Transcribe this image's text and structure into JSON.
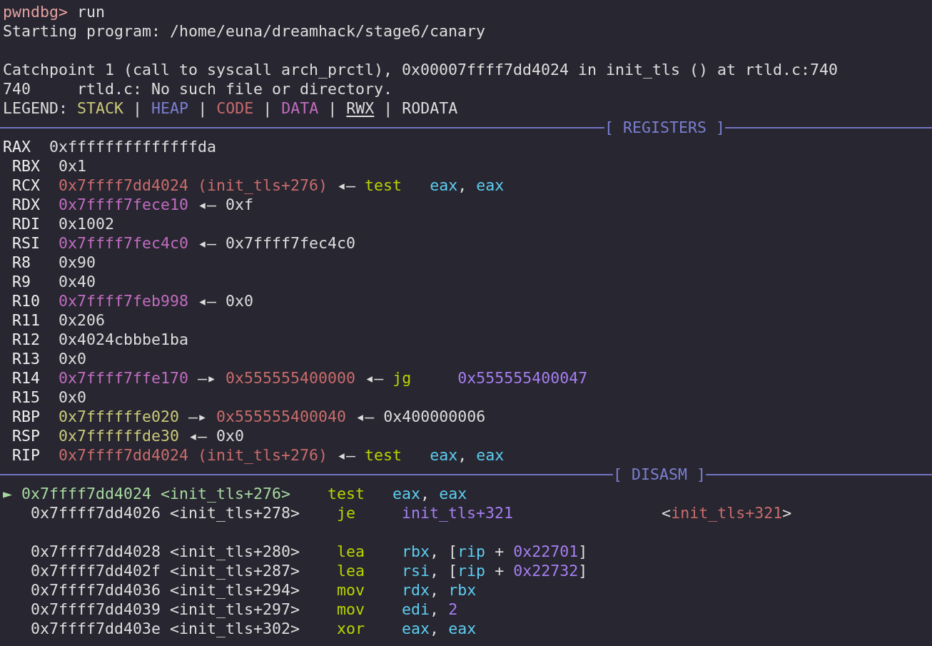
{
  "terminal": {
    "lines": [
      {
        "kind": "text",
        "segments": [
          {
            "text": "pwndbg>",
            "kind": "prompt"
          },
          {
            "text": " run",
            "kind": "plain"
          }
        ]
      },
      {
        "kind": "text",
        "segments": [
          {
            "text": "Starting program: /home/euna/dreamhack/stage6/canary",
            "kind": "plain"
          }
        ]
      },
      {
        "kind": "blank"
      },
      {
        "kind": "text",
        "segments": [
          {
            "text": "Catchpoint 1 (call to syscall arch_prctl), 0x00007ffff7dd4024 in init_tls () at rtld.c:740",
            "kind": "plain"
          }
        ]
      },
      {
        "kind": "text",
        "segments": [
          {
            "text": "740",
            "kind": "plain"
          },
          {
            "text": "     rtld.c: No such file or directory.",
            "kind": "plain"
          }
        ]
      },
      {
        "kind": "text",
        "segments": [
          {
            "text": "LEGEND:",
            "kind": "plain"
          },
          {
            "text": " STACK",
            "kind": "stack"
          },
          {
            "text": " |",
            "kind": "plain"
          },
          {
            "text": " HEAP",
            "kind": "heap"
          },
          {
            "text": " |",
            "kind": "plain"
          },
          {
            "text": " CODE",
            "kind": "code"
          },
          {
            "text": " |",
            "kind": "plain"
          },
          {
            "text": " DATA",
            "kind": "data"
          },
          {
            "text": " |",
            "kind": "plain"
          },
          {
            "text": " RWX",
            "kind": "rwx"
          },
          {
            "text": " |",
            "kind": "plain"
          },
          {
            "text": " RODATA",
            "kind": "plain"
          }
        ]
      },
      {
        "kind": "header",
        "label": "[ REGISTERS ]"
      },
      {
        "kind": "text",
        "segments": [
          {
            "text": "RAX",
            "kind": "regname"
          },
          {
            "text": "  0xffffffffffffffda",
            "kind": "plain"
          }
        ]
      },
      {
        "kind": "text",
        "segments": [
          {
            "text": " RBX",
            "kind": "regname"
          },
          {
            "text": "  0x1",
            "kind": "plain"
          }
        ]
      },
      {
        "kind": "text",
        "segments": [
          {
            "text": " RCX",
            "kind": "regname"
          },
          {
            "text": "  0x7ffff7dd4024 (init_tls+276)",
            "kind": "code"
          },
          {
            "text": " ◂—",
            "kind": "plain"
          },
          {
            "text": " test",
            "kind": "mnemonic"
          },
          {
            "text": "   eax",
            "kind": "reg"
          },
          {
            "text": ",",
            "kind": "plain"
          },
          {
            "text": " eax",
            "kind": "reg"
          }
        ]
      },
      {
        "kind": "text",
        "segments": [
          {
            "text": " RDX",
            "kind": "regname"
          },
          {
            "text": "  0x7ffff7fece10",
            "kind": "data"
          },
          {
            "text": " ◂—",
            "kind": "plain"
          },
          {
            "text": " 0xf",
            "kind": "plain"
          }
        ]
      },
      {
        "kind": "text",
        "segments": [
          {
            "text": " RDI",
            "kind": "regname"
          },
          {
            "text": "  0x1002",
            "kind": "plain"
          }
        ]
      },
      {
        "kind": "text",
        "segments": [
          {
            "text": " RSI",
            "kind": "regname"
          },
          {
            "text": "  0x7ffff7fec4c0",
            "kind": "data"
          },
          {
            "text": " ◂—",
            "kind": "plain"
          },
          {
            "text": " 0x7ffff7fec4c0",
            "kind": "plain"
          }
        ]
      },
      {
        "kind": "text",
        "segments": [
          {
            "text": " R8",
            "kind": "regname"
          },
          {
            "text": "   0x90",
            "kind": "plain"
          }
        ]
      },
      {
        "kind": "text",
        "segments": [
          {
            "text": " R9",
            "kind": "regname"
          },
          {
            "text": "   0x40",
            "kind": "plain"
          }
        ]
      },
      {
        "kind": "text",
        "segments": [
          {
            "text": " R10",
            "kind": "regname"
          },
          {
            "text": "  0x7ffff7feb998",
            "kind": "data"
          },
          {
            "text": " ◂—",
            "kind": "plain"
          },
          {
            "text": " 0x0",
            "kind": "plain"
          }
        ]
      },
      {
        "kind": "text",
        "segments": [
          {
            "text": " R11",
            "kind": "regname"
          },
          {
            "text": "  0x206",
            "kind": "plain"
          }
        ]
      },
      {
        "kind": "text",
        "segments": [
          {
            "text": " R12",
            "kind": "regname"
          },
          {
            "text": "  0x4024cbbbe1ba",
            "kind": "plain"
          }
        ]
      },
      {
        "kind": "text",
        "segments": [
          {
            "text": " R13",
            "kind": "regname"
          },
          {
            "text": "  0x0",
            "kind": "plain"
          }
        ]
      },
      {
        "kind": "text",
        "segments": [
          {
            "text": " R14",
            "kind": "regname"
          },
          {
            "text": "  0x7ffff7ffe170",
            "kind": "data"
          },
          {
            "text": " —▸",
            "kind": "plain"
          },
          {
            "text": " 0x555555400000",
            "kind": "code"
          },
          {
            "text": " ◂—",
            "kind": "plain"
          },
          {
            "text": " jg",
            "kind": "mnemonic"
          },
          {
            "text": "     0x555555400047",
            "kind": "imm"
          }
        ]
      },
      {
        "kind": "text",
        "segments": [
          {
            "text": " R15",
            "kind": "regname"
          },
          {
            "text": "  0x0",
            "kind": "plain"
          }
        ]
      },
      {
        "kind": "text",
        "segments": [
          {
            "text": " RBP",
            "kind": "regname"
          },
          {
            "text": "  0x7ffffffe020",
            "kind": "stack"
          },
          {
            "text": " —▸",
            "kind": "plain"
          },
          {
            "text": " 0x555555400040",
            "kind": "code"
          },
          {
            "text": " ◂—",
            "kind": "plain"
          },
          {
            "text": " 0x400000006",
            "kind": "plain"
          }
        ]
      },
      {
        "kind": "text",
        "segments": [
          {
            "text": " RSP",
            "kind": "regname"
          },
          {
            "text": "  0x7ffffffde30",
            "kind": "stack"
          },
          {
            "text": " ◂—",
            "kind": "plain"
          },
          {
            "text": " 0x0",
            "kind": "plain"
          }
        ]
      },
      {
        "kind": "text",
        "segments": [
          {
            "text": " RIP",
            "kind": "regname"
          },
          {
            "text": "  0x7ffff7dd4024 (init_tls+276)",
            "kind": "code"
          },
          {
            "text": " ◂—",
            "kind": "plain"
          },
          {
            "text": " test",
            "kind": "mnemonic"
          },
          {
            "text": "   eax",
            "kind": "reg"
          },
          {
            "text": ",",
            "kind": "plain"
          },
          {
            "text": " eax",
            "kind": "reg"
          }
        ]
      },
      {
        "kind": "header",
        "label": "[ DISASM ]"
      },
      {
        "kind": "text",
        "segments": [
          {
            "text": "►",
            "kind": "current"
          },
          {
            "text": " 0x7ffff7dd4024 <init_tls+276>",
            "kind": "current"
          },
          {
            "text": "    test",
            "kind": "mnemonic"
          },
          {
            "text": "   eax",
            "kind": "reg"
          },
          {
            "text": ",",
            "kind": "plain"
          },
          {
            "text": " eax",
            "kind": "reg"
          }
        ]
      },
      {
        "kind": "text",
        "segments": [
          {
            "text": "   0x7ffff7dd4026 <init_tls+278>",
            "kind": "plain"
          },
          {
            "text": "    je",
            "kind": "mnemonic"
          },
          {
            "text": "     init_tls+321",
            "kind": "imm"
          },
          {
            "text": "                <",
            "kind": "plain"
          },
          {
            "text": "init_tls+321",
            "kind": "code"
          },
          {
            "text": ">",
            "kind": "plain"
          }
        ]
      },
      {
        "kind": "blank"
      },
      {
        "kind": "text",
        "segments": [
          {
            "text": "   0x7ffff7dd4028 <init_tls+280>",
            "kind": "plain"
          },
          {
            "text": "    lea",
            "kind": "mnemonic"
          },
          {
            "text": "    rbx",
            "kind": "reg"
          },
          {
            "text": ", [",
            "kind": "plain"
          },
          {
            "text": "rip",
            "kind": "reg"
          },
          {
            "text": " +",
            "kind": "plain"
          },
          {
            "text": " 0x22701",
            "kind": "imm"
          },
          {
            "text": "]",
            "kind": "plain"
          }
        ]
      },
      {
        "kind": "text",
        "segments": [
          {
            "text": "   0x7ffff7dd402f <init_tls+287>",
            "kind": "plain"
          },
          {
            "text": "    lea",
            "kind": "mnemonic"
          },
          {
            "text": "    rsi",
            "kind": "reg"
          },
          {
            "text": ", [",
            "kind": "plain"
          },
          {
            "text": "rip",
            "kind": "reg"
          },
          {
            "text": " +",
            "kind": "plain"
          },
          {
            "text": " 0x22732",
            "kind": "imm"
          },
          {
            "text": "]",
            "kind": "plain"
          }
        ]
      },
      {
        "kind": "text",
        "segments": [
          {
            "text": "   0x7ffff7dd4036 <init_tls+294>",
            "kind": "plain"
          },
          {
            "text": "    mov",
            "kind": "mnemonic"
          },
          {
            "text": "    rdx",
            "kind": "reg"
          },
          {
            "text": ",",
            "kind": "plain"
          },
          {
            "text": " rbx",
            "kind": "reg"
          }
        ]
      },
      {
        "kind": "text",
        "segments": [
          {
            "text": "   0x7ffff7dd4039 <init_tls+297>",
            "kind": "plain"
          },
          {
            "text": "    mov",
            "kind": "mnemonic"
          },
          {
            "text": "    edi",
            "kind": "reg"
          },
          {
            "text": ",",
            "kind": "plain"
          },
          {
            "text": " 2",
            "kind": "imm"
          }
        ]
      },
      {
        "kind": "text",
        "segments": [
          {
            "text": "   0x7ffff7dd403e <init_tls+302>",
            "kind": "plain"
          },
          {
            "text": "    xor",
            "kind": "mnemonic"
          },
          {
            "text": "    eax",
            "kind": "reg"
          },
          {
            "text": ",",
            "kind": "plain"
          },
          {
            "text": " eax",
            "kind": "reg"
          }
        ]
      }
    ]
  }
}
